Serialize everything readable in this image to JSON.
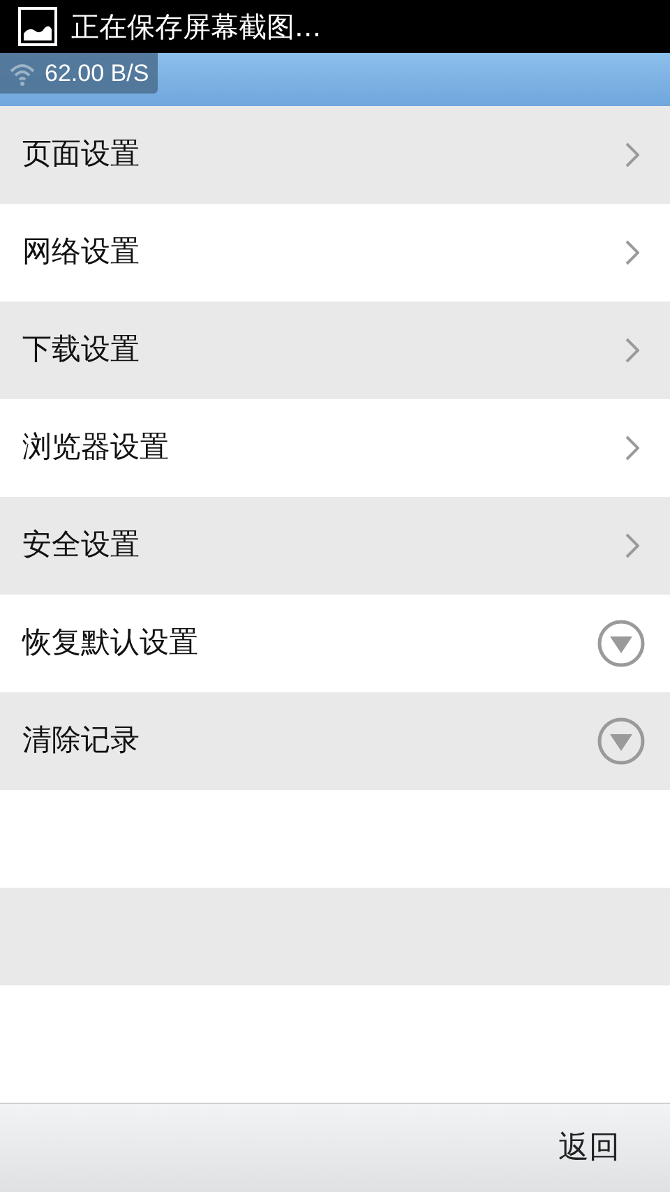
{
  "notification": {
    "text": "正在保存屏幕截图..."
  },
  "speed_overlay": {
    "text": "62.00 B/S"
  },
  "items": [
    {
      "label": "页面设置",
      "kind": "chevron"
    },
    {
      "label": "网络设置",
      "kind": "chevron"
    },
    {
      "label": "下载设置",
      "kind": "chevron"
    },
    {
      "label": "浏览器设置",
      "kind": "chevron"
    },
    {
      "label": "安全设置",
      "kind": "chevron"
    },
    {
      "label": "恢复默认设置",
      "kind": "dropdown"
    },
    {
      "label": "清除记录",
      "kind": "dropdown"
    }
  ],
  "bottom_bar": {
    "back_button": "返回"
  }
}
